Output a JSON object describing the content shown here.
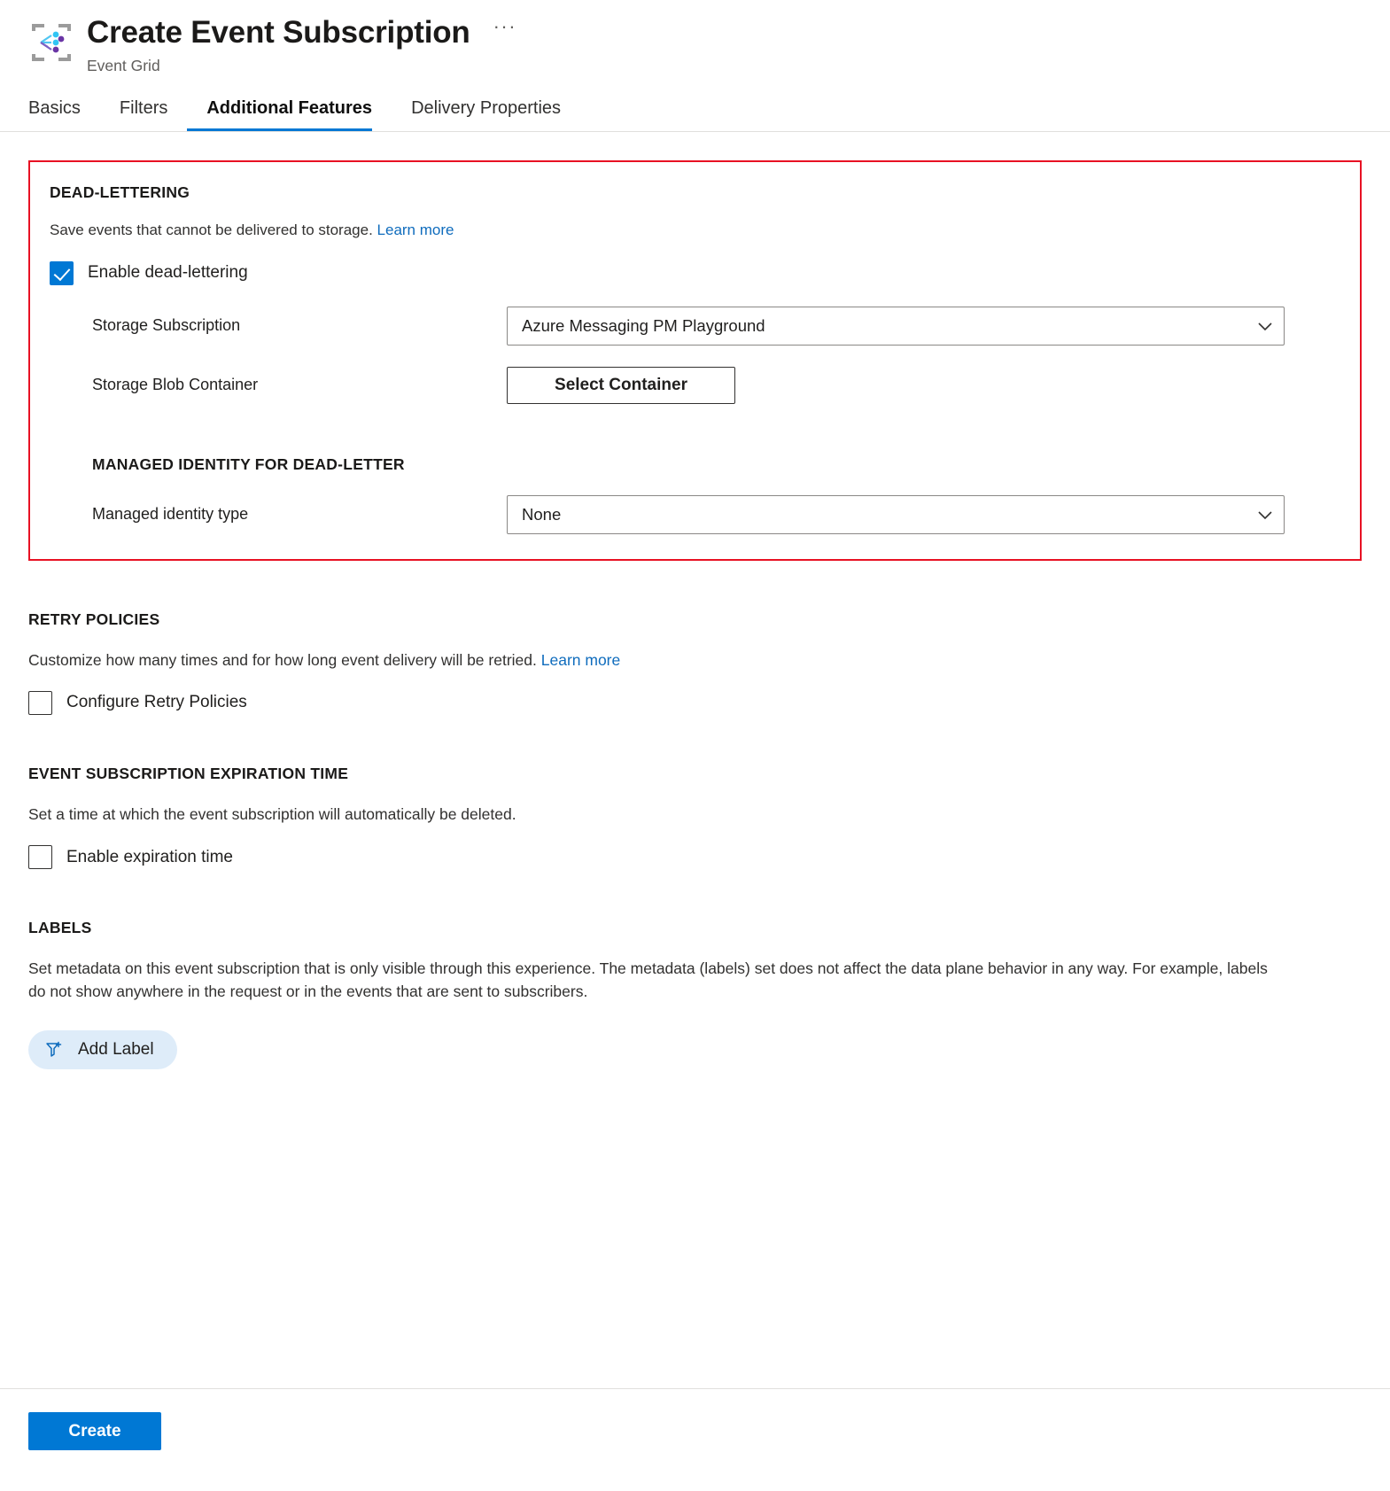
{
  "header": {
    "icon_name": "event-grid-icon",
    "title": "Create Event Subscription",
    "subtitle": "Event Grid",
    "more_menu": "···"
  },
  "tabs": [
    {
      "label": "Basics",
      "active": false
    },
    {
      "label": "Filters",
      "active": false
    },
    {
      "label": "Additional Features",
      "active": true
    },
    {
      "label": "Delivery Properties",
      "active": false
    }
  ],
  "dead_lettering": {
    "heading": "DEAD-LETTERING",
    "description": "Save events that cannot be delivered to storage.",
    "learn_more": "Learn more",
    "enable_checkbox": {
      "label": "Enable dead-lettering",
      "checked": true
    },
    "storage_subscription": {
      "label": "Storage Subscription",
      "value": "Azure Messaging PM Playground"
    },
    "storage_blob_container": {
      "label": "Storage Blob Container",
      "button_label": "Select Container"
    },
    "managed_identity": {
      "heading": "MANAGED IDENTITY FOR DEAD-LETTER",
      "label": "Managed identity type",
      "value": "None"
    },
    "highlight_color": "#e81123"
  },
  "retry_policies": {
    "heading": "RETRY POLICIES",
    "description": "Customize how many times and for how long event delivery will be retried.",
    "learn_more": "Learn more",
    "checkbox": {
      "label": "Configure Retry Policies",
      "checked": false
    }
  },
  "expiration": {
    "heading": "EVENT SUBSCRIPTION EXPIRATION TIME",
    "description": "Set a time at which the event subscription will automatically be deleted.",
    "checkbox": {
      "label": "Enable expiration time",
      "checked": false
    }
  },
  "labels": {
    "heading": "LABELS",
    "description": "Set metadata on this event subscription that is only visible through this experience. The metadata (labels) set does not affect the data plane behavior in any way. For example, labels do not show anywhere in the request or in the events that are sent to subscribers.",
    "add_label_button": "Add Label",
    "add_label_icon": "add-filter-icon"
  },
  "footer": {
    "create_button": "Create",
    "accent_color": "#0078d4"
  }
}
